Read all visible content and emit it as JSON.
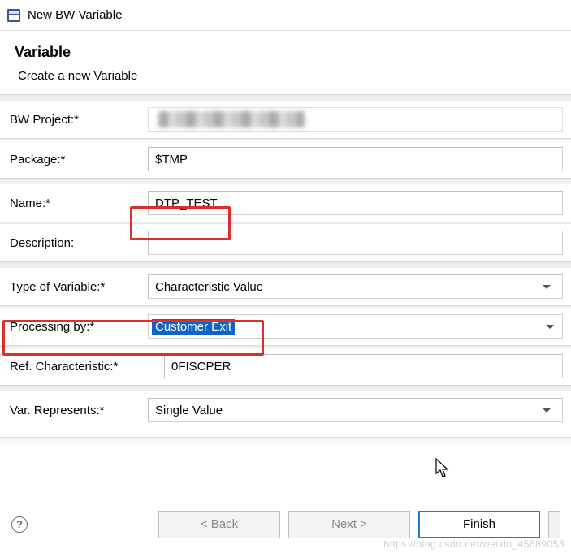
{
  "titlebar": {
    "title": "New BW Variable"
  },
  "header": {
    "title": "Variable",
    "subtitle": "Create a new Variable"
  },
  "form": {
    "bw_project": {
      "label": "BW Project:*",
      "value": ""
    },
    "package": {
      "label": "Package:*",
      "value": "$TMP"
    },
    "name": {
      "label": "Name:*",
      "value": "DTP_TEST"
    },
    "description": {
      "label": "Description:",
      "value": ""
    },
    "type": {
      "label": "Type of Variable:*",
      "value": "Characteristic Value"
    },
    "processing": {
      "label": "Processing by:*",
      "value": "Customer Exit"
    },
    "ref_char": {
      "label": "Ref. Characteristic:*",
      "value": "0FISCPER"
    },
    "represents": {
      "label": "Var. Represents:*",
      "value": "Single Value"
    }
  },
  "buttons": {
    "back": "< Back",
    "next": "Next >",
    "finish": "Finish"
  },
  "watermark": "https://blog.csdn.net/weixin_45689053"
}
